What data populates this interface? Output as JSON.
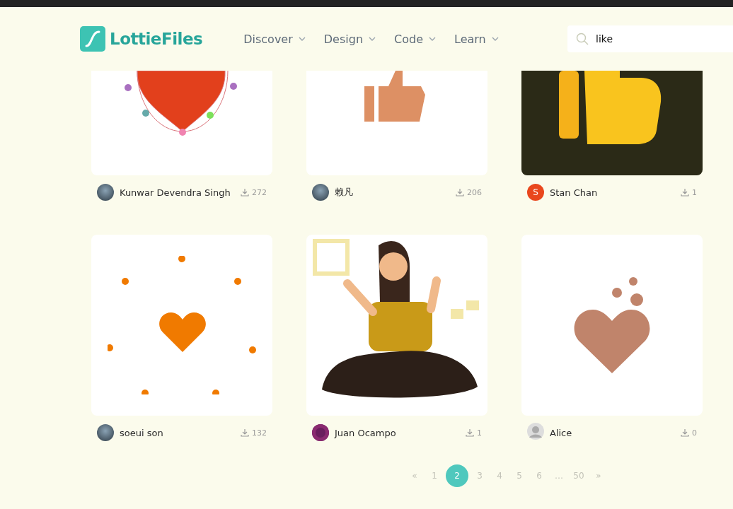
{
  "header": {
    "logo": "LottieFiles",
    "nav": [
      {
        "label": "Discover"
      },
      {
        "label": "Design"
      },
      {
        "label": "Code"
      },
      {
        "label": "Learn"
      }
    ],
    "search": {
      "value": "like"
    }
  },
  "cards": [
    {
      "kind": "heart-editor",
      "author": "Kunwar Devendra Singh",
      "avatar": {
        "kind": "photo"
      },
      "downloads": "272"
    },
    {
      "kind": "thumb-flat",
      "author": "赖凡",
      "avatar": {
        "kind": "photo"
      },
      "downloads": "206"
    },
    {
      "kind": "thumb-dark",
      "author": "Stan Chan",
      "avatar": {
        "kind": "letter",
        "letter": "S"
      },
      "downloads": "1"
    },
    {
      "kind": "heart-burst",
      "author": "soeui son",
      "avatar": {
        "kind": "photo"
      },
      "downloads": "132"
    },
    {
      "kind": "person",
      "author": "Juan Ocampo",
      "avatar": {
        "kind": "badge"
      },
      "downloads": "1"
    },
    {
      "kind": "hearts",
      "author": "Alice",
      "avatar": {
        "kind": "silhouette"
      },
      "downloads": "0"
    }
  ],
  "pagination": {
    "prev": "«",
    "next": "»",
    "pages": [
      {
        "label": "1",
        "selected": false
      },
      {
        "label": "2",
        "selected": true
      },
      {
        "label": "3",
        "selected": false
      },
      {
        "label": "4",
        "selected": false
      },
      {
        "label": "5",
        "selected": false
      },
      {
        "label": "6",
        "selected": false
      },
      {
        "label": "…",
        "selected": false
      },
      {
        "label": "50",
        "selected": false
      }
    ]
  }
}
